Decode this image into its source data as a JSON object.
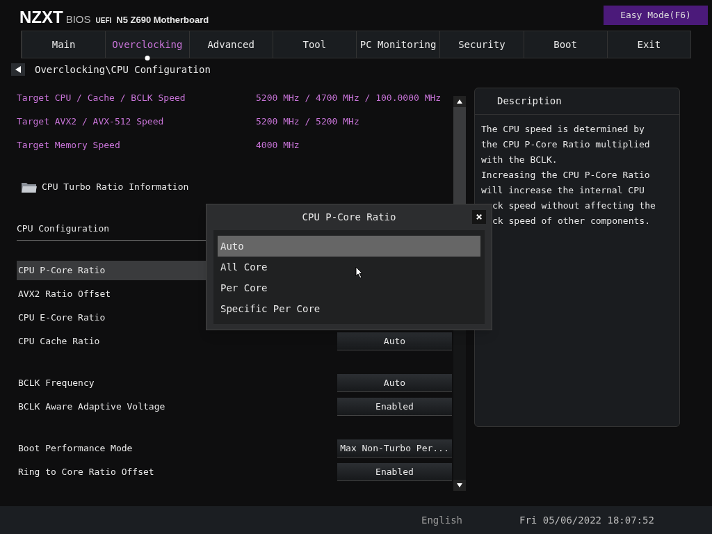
{
  "header": {
    "brand": "NZXT",
    "product": "BIOS",
    "firmware": "UEFI",
    "board": "N5 Z690 Motherboard",
    "mode_button": "Easy Mode(F6)"
  },
  "tabs": [
    {
      "label": "Main",
      "selected": false
    },
    {
      "label": "Overclocking",
      "selected": true
    },
    {
      "label": "Advanced",
      "selected": false
    },
    {
      "label": "Tool",
      "selected": false
    },
    {
      "label": "PC Monitoring",
      "selected": false
    },
    {
      "label": "Security",
      "selected": false
    },
    {
      "label": "Boot",
      "selected": false
    },
    {
      "label": "Exit",
      "selected": false
    }
  ],
  "breadcrumb": "Overclocking\\CPU Configuration",
  "settings_groups": [
    [
      {
        "kind": "info",
        "label": "Target CPU / Cache / BCLK Speed",
        "value": "5200 MHz / 4700 MHz / 100.0000 MHz"
      },
      {
        "kind": "info",
        "label": "Target AVX2 / AVX-512 Speed",
        "value": "5200 MHz / 5200 MHz"
      },
      {
        "kind": "info",
        "label": "Target Memory Speed",
        "value": "4000 MHz"
      }
    ],
    [
      {
        "kind": "folder",
        "label": "CPU Turbo Ratio Information"
      }
    ],
    [
      {
        "kind": "section",
        "label": "CPU Configuration"
      }
    ],
    [
      {
        "kind": "setting",
        "label": "CPU P-Core Ratio",
        "selected": true
      },
      {
        "kind": "setting",
        "label": "AVX2 Ratio Offset",
        "selected": false
      },
      {
        "kind": "setting",
        "label": "CPU E-Core Ratio",
        "selected": false
      },
      {
        "kind": "setting",
        "label": "CPU Cache  Ratio",
        "selected": false,
        "value": "Auto"
      }
    ],
    [
      {
        "kind": "setting",
        "label": "BCLK Frequency",
        "selected": false,
        "value": "Auto"
      },
      {
        "kind": "setting",
        "label": "BCLK Aware Adaptive Voltage",
        "selected": false,
        "value": "Enabled"
      }
    ],
    [
      {
        "kind": "setting",
        "label": "Boot Performance Mode",
        "selected": false,
        "value": "Max Non-Turbo Per..."
      },
      {
        "kind": "setting",
        "label": "Ring to Core Ratio Offset",
        "selected": false,
        "value": "Enabled"
      }
    ]
  ],
  "description": {
    "title": "Description",
    "lines": [
      "The CPU speed is determined by",
      "the CPU P-Core Ratio multiplied",
      "with the BCLK.",
      "Increasing the CPU P-Core Ratio",
      "will increase the internal CPU",
      "ck speed without affecting the",
      "ck speed of other components."
    ]
  },
  "dialog": {
    "title": "CPU P-Core Ratio",
    "close": "×",
    "options": [
      {
        "label": "Auto",
        "selected": true
      },
      {
        "label": "All Core",
        "selected": false
      },
      {
        "label": "Per Core",
        "selected": false
      },
      {
        "label": "Specific Per Core",
        "selected": false
      }
    ]
  },
  "status_bar": {
    "language": "English",
    "datetime": "Fri 05/06/2022 18:07:52"
  }
}
